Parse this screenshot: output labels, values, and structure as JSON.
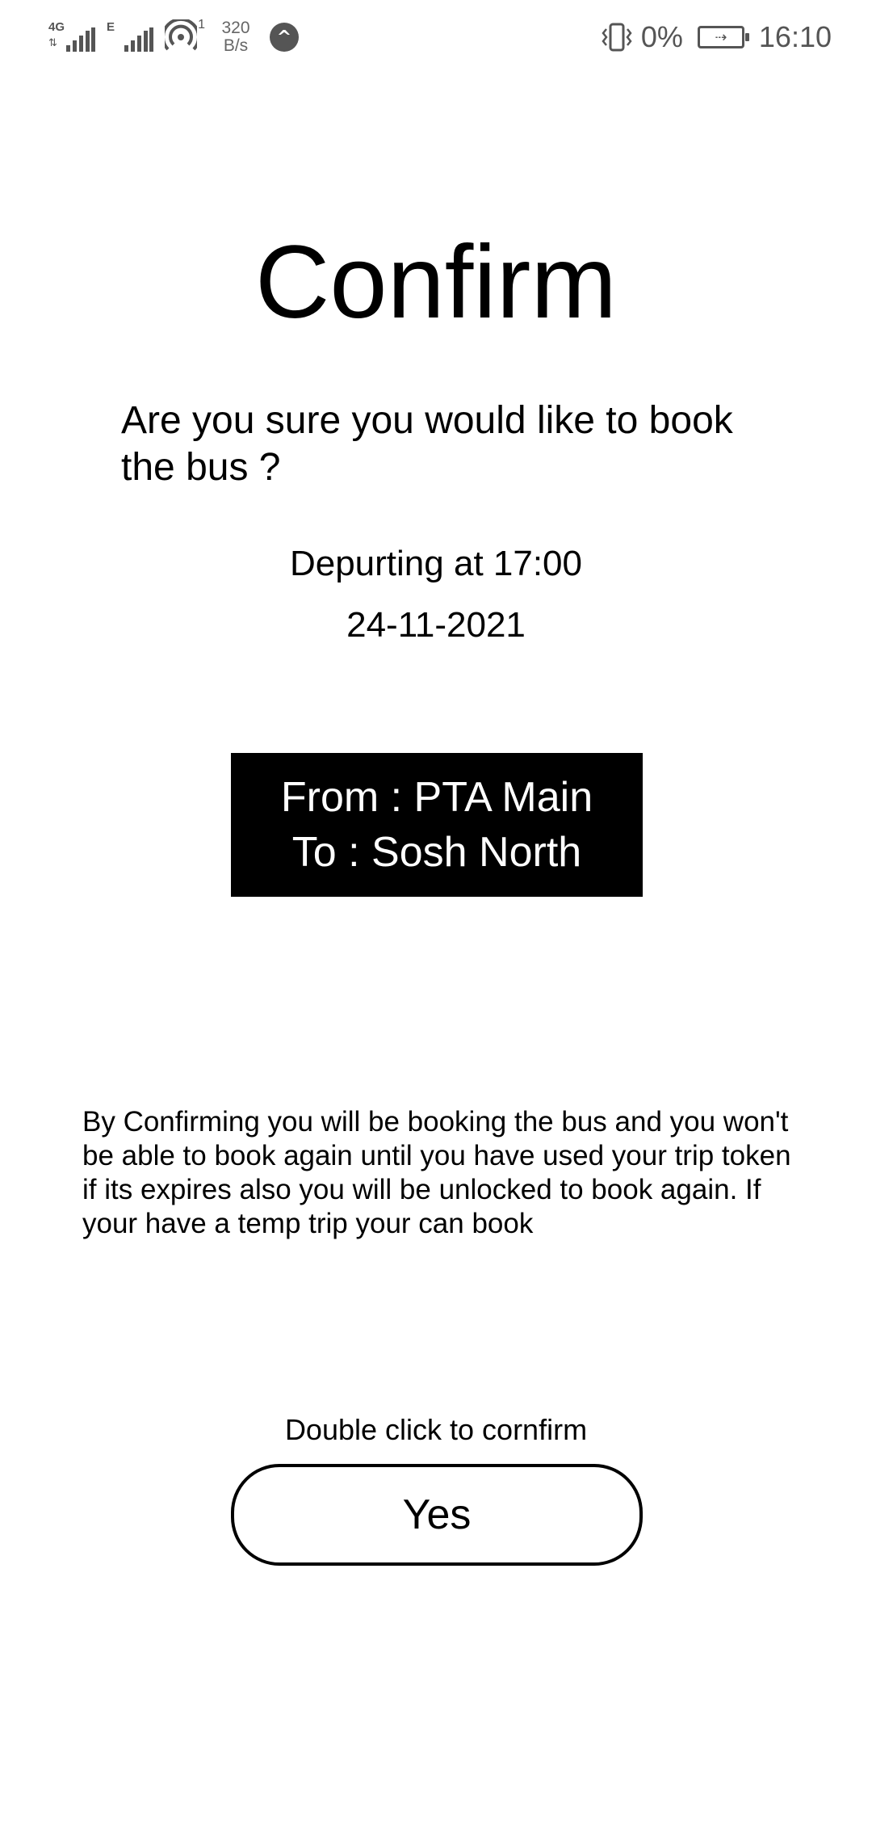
{
  "status_bar": {
    "network_1": "4G",
    "network_2": "E",
    "hotspot_count": "1",
    "speed_value": "320",
    "speed_unit": "B/s",
    "battery_percent": "0%",
    "time": "16:10",
    "icons": [
      "signal-4g-icon",
      "signal-e-icon",
      "hotspot-icon",
      "notification-icon",
      "vibrate-icon",
      "battery-charging-icon"
    ]
  },
  "main": {
    "title": "Confirm",
    "question": "Are you sure you would like to book the bus ?",
    "departure": "Depurting at 17:00",
    "date": "24-11-2021",
    "route": {
      "from": "From : PTA Main",
      "to": "To : Sosh North"
    },
    "disclaimer": "By Confirming you will be booking the bus and you won't be able to book again until you have used your trip token if its expires also you will be unlocked to book again. If your have a temp trip your can book",
    "hint": "Double click to cornfirm",
    "confirm_button": "Yes"
  }
}
